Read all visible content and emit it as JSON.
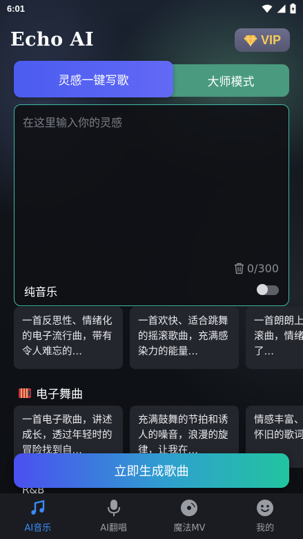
{
  "status_bar": {
    "time": "6:01"
  },
  "header": {
    "title": "Echo AI",
    "vip_label": "VIP"
  },
  "tabs": [
    {
      "label": "灵感一键写歌",
      "active": true
    },
    {
      "label": "大师模式",
      "active": false
    }
  ],
  "input": {
    "placeholder": "在这里输入你的灵感",
    "value": "",
    "char_count": "0/300",
    "pure_music_label": "纯音乐",
    "pure_music_on": false
  },
  "suggestions_top": [
    "一首反思性、情绪化的电子流行曲，带有令人难忘的…",
    "一首欢快、适合跳舞的摇滚歌曲，充满感染力的能量…",
    "一首朗朗上口的流行摇滚曲，情绪变化反映了…"
  ],
  "section_electronic": {
    "title": "电子舞曲",
    "cards": [
      "一首电子歌曲，讲述成长，透过年轻时的冒险找到自…",
      "充满鼓舞的节拍和诱人的噪音，浪漫的旋律，让我在…",
      "情感丰富、带有噪音和怀旧的歌词，讲述爱…"
    ]
  },
  "section_next_title": "R&B",
  "generate_label": "立即生成歌曲",
  "nav": [
    {
      "label": "AI音乐",
      "active": true,
      "icon": "music-note-icon"
    },
    {
      "label": "AI翻唱",
      "active": false,
      "icon": "microphone-icon"
    },
    {
      "label": "魔法MV",
      "active": false,
      "icon": "disc-icon"
    },
    {
      "label": "我的",
      "active": false,
      "icon": "smiley-icon"
    }
  ],
  "colors": {
    "accent_blue": "#4b5cf0",
    "accent_teal": "#3fb9a5",
    "nav_active": "#3a8cf6",
    "vip_gold": "#f5c95a"
  }
}
